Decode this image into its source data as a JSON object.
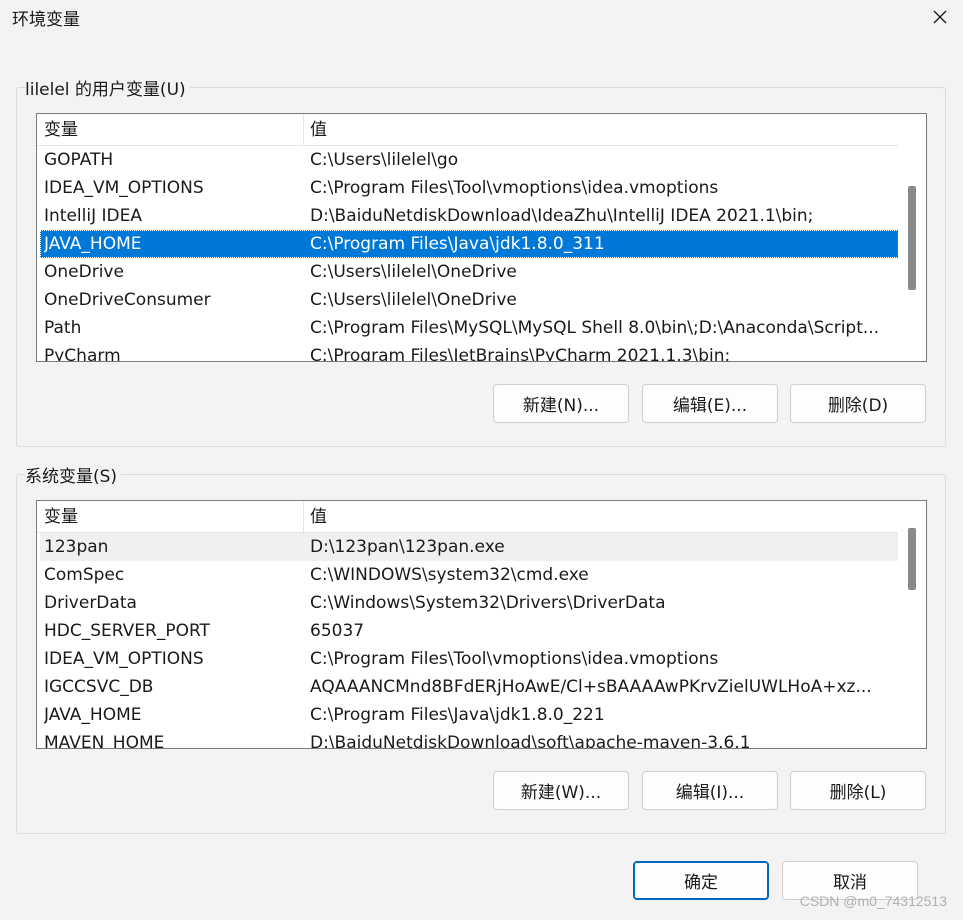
{
  "window": {
    "title": "环境变量",
    "close_icon": "close-icon"
  },
  "user_vars": {
    "group_label": "lilelel 的用户变量(U)",
    "columns": {
      "name": "变量",
      "value": "值"
    },
    "rows": [
      {
        "name": "GOPATH",
        "value": "C:\\Users\\lilelel\\go"
      },
      {
        "name": "IDEA_VM_OPTIONS",
        "value": "C:\\Program Files\\Tool\\vmoptions\\idea.vmoptions"
      },
      {
        "name": "IntelliJ IDEA",
        "value": "D:\\BaiduNetdiskDownload\\IdeaZhu\\IntelliJ IDEA 2021.1\\bin;"
      },
      {
        "name": "JAVA_HOME",
        "value": "C:\\Program Files\\Java\\jdk1.8.0_311"
      },
      {
        "name": "OneDrive",
        "value": "C:\\Users\\lilelel\\OneDrive"
      },
      {
        "name": "OneDriveConsumer",
        "value": "C:\\Users\\lilelel\\OneDrive"
      },
      {
        "name": "Path",
        "value": "C:\\Program Files\\MySQL\\MySQL Shell 8.0\\bin\\;D:\\Anaconda\\Script..."
      },
      {
        "name": "PyCharm",
        "value": "C:\\Program Files\\JetBrains\\PyCharm 2021.1.3\\bin;"
      }
    ],
    "selected_index": 3,
    "buttons": {
      "new": "新建(N)...",
      "edit": "编辑(E)...",
      "delete": "删除(D)"
    }
  },
  "system_vars": {
    "group_label": "系统变量(S)",
    "columns": {
      "name": "变量",
      "value": "值"
    },
    "rows": [
      {
        "name": "123pan",
        "value": "D:\\123pan\\123pan.exe"
      },
      {
        "name": "ComSpec",
        "value": "C:\\WINDOWS\\system32\\cmd.exe"
      },
      {
        "name": "DriverData",
        "value": "C:\\Windows\\System32\\Drivers\\DriverData"
      },
      {
        "name": "HDC_SERVER_PORT",
        "value": "65037"
      },
      {
        "name": "IDEA_VM_OPTIONS",
        "value": "C:\\Program Files\\Tool\\vmoptions\\idea.vmoptions"
      },
      {
        "name": "IGCCSVC_DB",
        "value": "AQAAANCMnd8BFdERjHoAwE/Cl+sBAAAAwPKrvZielUWLHoA+xz..."
      },
      {
        "name": "JAVA_HOME",
        "value": "C:\\Program Files\\Java\\jdk1.8.0_221"
      },
      {
        "name": "MAVEN_HOME",
        "value": "D:\\BaiduNetdiskDownload\\soft\\apache-maven-3.6.1"
      }
    ],
    "hover_index": 0,
    "buttons": {
      "new": "新建(W)...",
      "edit": "编辑(I)...",
      "delete": "删除(L)"
    }
  },
  "footer": {
    "ok": "确定",
    "cancel": "取消",
    "watermark": "CSDN @m0_74312513"
  },
  "colors": {
    "selection": "#0078d7",
    "primary_border": "#0067c0"
  }
}
